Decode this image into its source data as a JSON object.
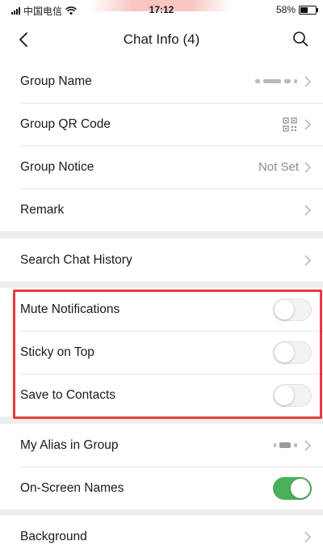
{
  "status_bar": {
    "carrier": "中国电信",
    "time": "17:12",
    "battery": "58%",
    "battery_level": 0.58
  },
  "header": {
    "title": "Chat Info (4)",
    "back_icon": "chevron-left-icon",
    "search_icon": "search-icon"
  },
  "sections": {
    "info": [
      {
        "label": "Group Name",
        "value": ""
      },
      {
        "label": "Group QR Code",
        "value": ""
      },
      {
        "label": "Group Notice",
        "value": "Not Set"
      },
      {
        "label": "Remark",
        "value": ""
      }
    ],
    "search": {
      "label": "Search Chat History"
    },
    "toggles": [
      {
        "label": "Mute Notifications",
        "on": false
      },
      {
        "label": "Sticky on Top",
        "on": false
      },
      {
        "label": "Save to Contacts",
        "on": false
      }
    ],
    "alias": {
      "label": "My Alias in Group",
      "value": ""
    },
    "onscreen": {
      "label": "On-Screen Names",
      "on": true
    },
    "background": {
      "label": "Background"
    }
  },
  "colors": {
    "toggle_on": "#4cb05a",
    "highlight": "#e83a3a",
    "page_bg": "#ededed"
  }
}
